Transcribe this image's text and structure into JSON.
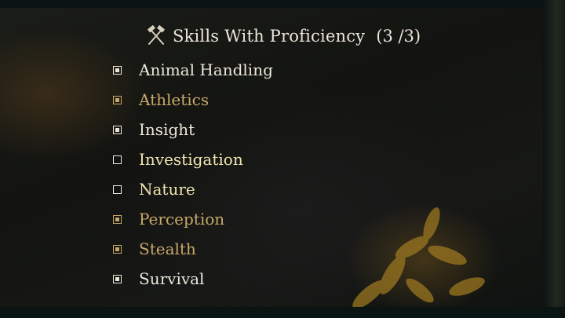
{
  "header": {
    "title": "Skills With Proficiency",
    "count": "(3 /3)",
    "icon": "crossed-hammers-icon"
  },
  "colors": {
    "white": "#ece6da",
    "gold": "#c8a86a",
    "yellow": "#efe3b0",
    "background": "#0d1512"
  },
  "skills": [
    {
      "label": "Animal Handling",
      "checked": true,
      "color": "#ece6da"
    },
    {
      "label": "Athletics",
      "checked": true,
      "color": "#c8a86a"
    },
    {
      "label": "Insight",
      "checked": true,
      "color": "#ece6da"
    },
    {
      "label": "Investigation",
      "checked": false,
      "color": "#efe3b0"
    },
    {
      "label": "Nature",
      "checked": false,
      "color": "#efe3b0"
    },
    {
      "label": "Perception",
      "checked": true,
      "color": "#c8a86a"
    },
    {
      "label": "Stealth",
      "checked": true,
      "color": "#c8a86a"
    },
    {
      "label": "Survival",
      "checked": true,
      "color": "#ece6da"
    }
  ]
}
